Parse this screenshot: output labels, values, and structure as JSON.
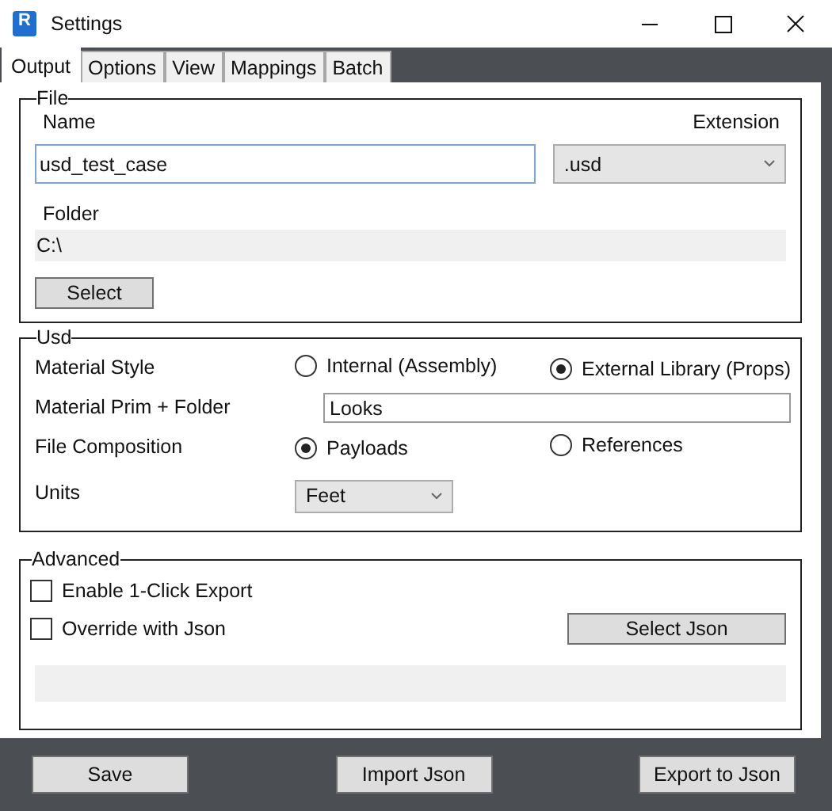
{
  "window": {
    "title": "Settings",
    "icon_letter": "R"
  },
  "tabs": [
    {
      "label": "Output",
      "selected": true
    },
    {
      "label": "Options",
      "selected": false
    },
    {
      "label": "View",
      "selected": false
    },
    {
      "label": "Mappings",
      "selected": false
    },
    {
      "label": "Batch",
      "selected": false
    }
  ],
  "file_group": {
    "legend": "File",
    "name_label": "Name",
    "extension_label": "Extension",
    "name_value": "usd_test_case",
    "extension_value": ".usd",
    "folder_label": "Folder",
    "folder_value": "C:\\",
    "select_button": "Select"
  },
  "usd_group": {
    "legend": "Usd",
    "rows": [
      {
        "kind": "radio",
        "label": "Material Style",
        "options": [
          {
            "label": "Internal (Assembly)",
            "selected": false
          },
          {
            "label": "External Library (Props)",
            "selected": true
          }
        ]
      },
      {
        "kind": "text",
        "label": "Material Prim + Folder",
        "value": "Looks"
      },
      {
        "kind": "radio",
        "label": "File Composition",
        "options": [
          {
            "label": "Payloads",
            "selected": true
          },
          {
            "label": "References",
            "selected": false
          }
        ]
      },
      {
        "kind": "dropdown",
        "label": "Units",
        "value": "Feet"
      }
    ]
  },
  "advanced_group": {
    "legend": "Advanced",
    "checkboxes": [
      {
        "label": "Enable 1-Click Export",
        "checked": false
      },
      {
        "label": "Override with Json",
        "checked": false
      }
    ],
    "select_json_button": "Select Json"
  },
  "buttons": [
    "Save",
    "Import Json",
    "Export to Json"
  ]
}
